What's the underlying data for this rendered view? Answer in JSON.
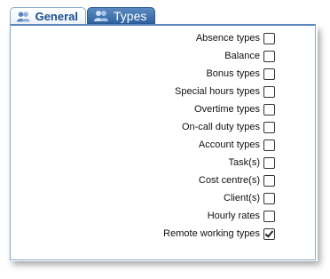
{
  "tabs": [
    {
      "label": "General",
      "icon": "users-icon",
      "active": false
    },
    {
      "label": "Types",
      "icon": "users-icon",
      "active": true
    }
  ],
  "options": [
    {
      "label": "Absence types",
      "checked": false
    },
    {
      "label": "Balance",
      "checked": false
    },
    {
      "label": "Bonus types",
      "checked": false
    },
    {
      "label": "Special hours types",
      "checked": false
    },
    {
      "label": "Overtime types",
      "checked": false
    },
    {
      "label": "On-call duty types",
      "checked": false
    },
    {
      "label": "Account types",
      "checked": false
    },
    {
      "label": "Task(s)",
      "checked": false
    },
    {
      "label": "Cost centre(s)",
      "checked": false
    },
    {
      "label": "Client(s)",
      "checked": false
    },
    {
      "label": "Hourly rates",
      "checked": false
    },
    {
      "label": "Remote working types",
      "checked": true
    }
  ],
  "colors": {
    "tab_active": "#3a6eab",
    "border": "#8aa9cc",
    "tab_text": "#1b4f8c"
  }
}
